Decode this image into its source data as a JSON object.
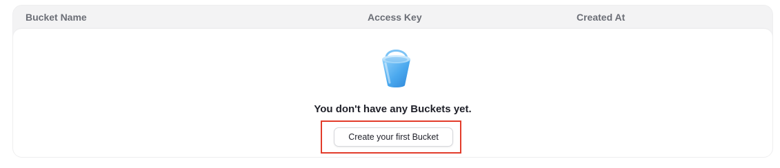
{
  "table": {
    "columns": [
      "Bucket Name",
      "Access Key",
      "Created At"
    ]
  },
  "empty_state": {
    "icon": "bucket-icon",
    "message": "You don't have any Buckets yet.",
    "cta_label": "Create your first Bucket"
  },
  "colors": {
    "highlight": "#e23b2a",
    "bucket": "#5fb6f3"
  }
}
